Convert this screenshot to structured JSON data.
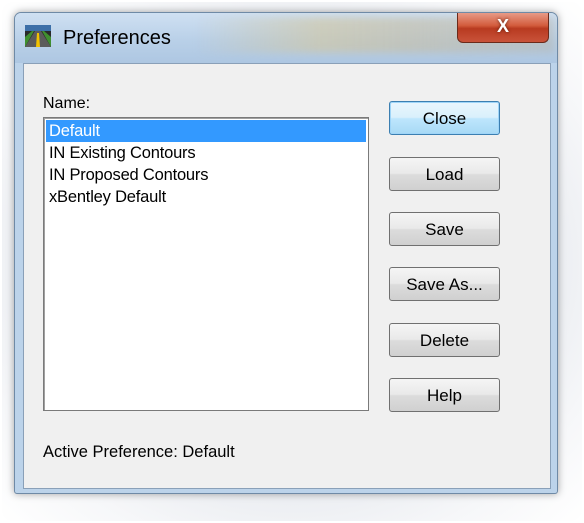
{
  "window": {
    "title": "Preferences",
    "close_glyph": "X"
  },
  "dialog": {
    "name_label": "Name:",
    "list_items": [
      {
        "label": "Default",
        "selected": true
      },
      {
        "label": "IN Existing Contours",
        "selected": false
      },
      {
        "label": "IN Proposed Contours",
        "selected": false
      },
      {
        "label": "xBentley Default",
        "selected": false
      }
    ],
    "buttons": {
      "close": "Close",
      "load": "Load",
      "save": "Save",
      "save_as": "Save As...",
      "delete": "Delete",
      "help": "Help"
    },
    "active_preference": "Active Preference: Default"
  },
  "colors": {
    "selection": "#3399ff",
    "title_close_button": "#c8432a",
    "dialog_background": "#f0f0f0"
  },
  "icons": {
    "app": "road-app-icon",
    "close": "close-icon"
  }
}
